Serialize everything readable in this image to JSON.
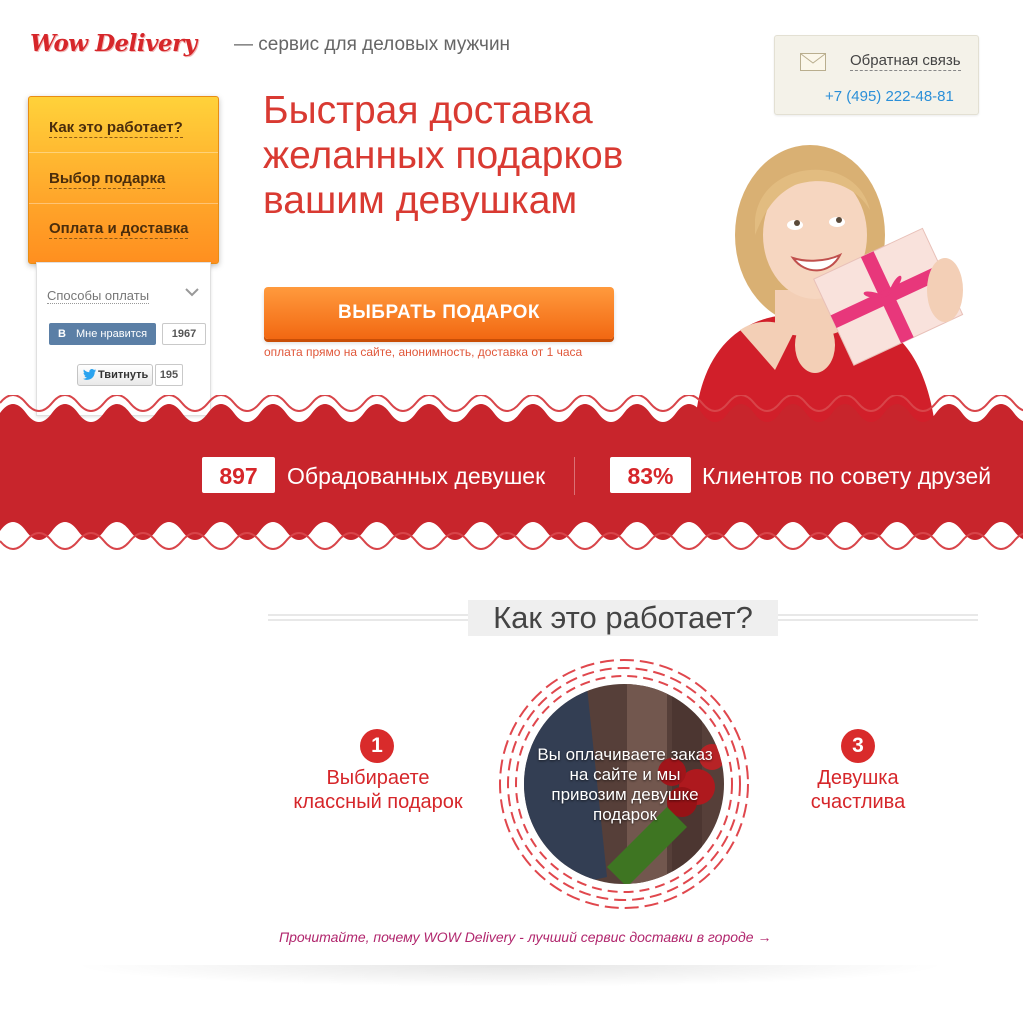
{
  "header": {
    "logo": "Wow Delivery",
    "tagline": "— сервис для деловых мужчин"
  },
  "contact": {
    "feedback_label": "Обратная связь",
    "phone": "+7 (495) 222-48-81",
    "icon": "mail-icon"
  },
  "menu": {
    "items": [
      {
        "label": "Как это работает?"
      },
      {
        "label": "Выбор подарка"
      },
      {
        "label": "Оплата и доставка"
      }
    ]
  },
  "side": {
    "payment_methods": "Способы оплаты",
    "vk_label": "Мне нравится",
    "vk_count": "1967",
    "vk_logo": "В",
    "tweet_label": "Твитнуть",
    "tweet_count": "195"
  },
  "hero": {
    "title_line1": "Быстрая доставка",
    "title_line2": "желанных подарков",
    "title_line3": "вашим девушкам",
    "cta": "ВЫБРАТЬ ПОДАРОК",
    "cta_note": "оплата прямо на сайте, анонимность, доставка от 1 часа"
  },
  "stats": [
    {
      "value": "897",
      "label": "Обрадованных девушек"
    },
    {
      "value": "83%",
      "label": "Клиентов по совету друзей"
    }
  ],
  "how": {
    "title": "Как это работает?",
    "steps": [
      {
        "num": "1",
        "line1": "Выбираете",
        "line2": "классный подарок"
      },
      {
        "num": "3",
        "line1": "Девушка",
        "line2": "счастлива"
      }
    ],
    "middle_text": "Вы оплачиваете заказ на сайте и мы привозим девушке подарок",
    "read_more": "Прочитайте, почему WOW Delivery - лучший сервис доставки в городе →"
  },
  "colors": {
    "brand_red": "#d6262a",
    "menu_orange": "#ffa72b",
    "cta_orange": "#f26812",
    "link_blue": "#2a8fd8"
  }
}
